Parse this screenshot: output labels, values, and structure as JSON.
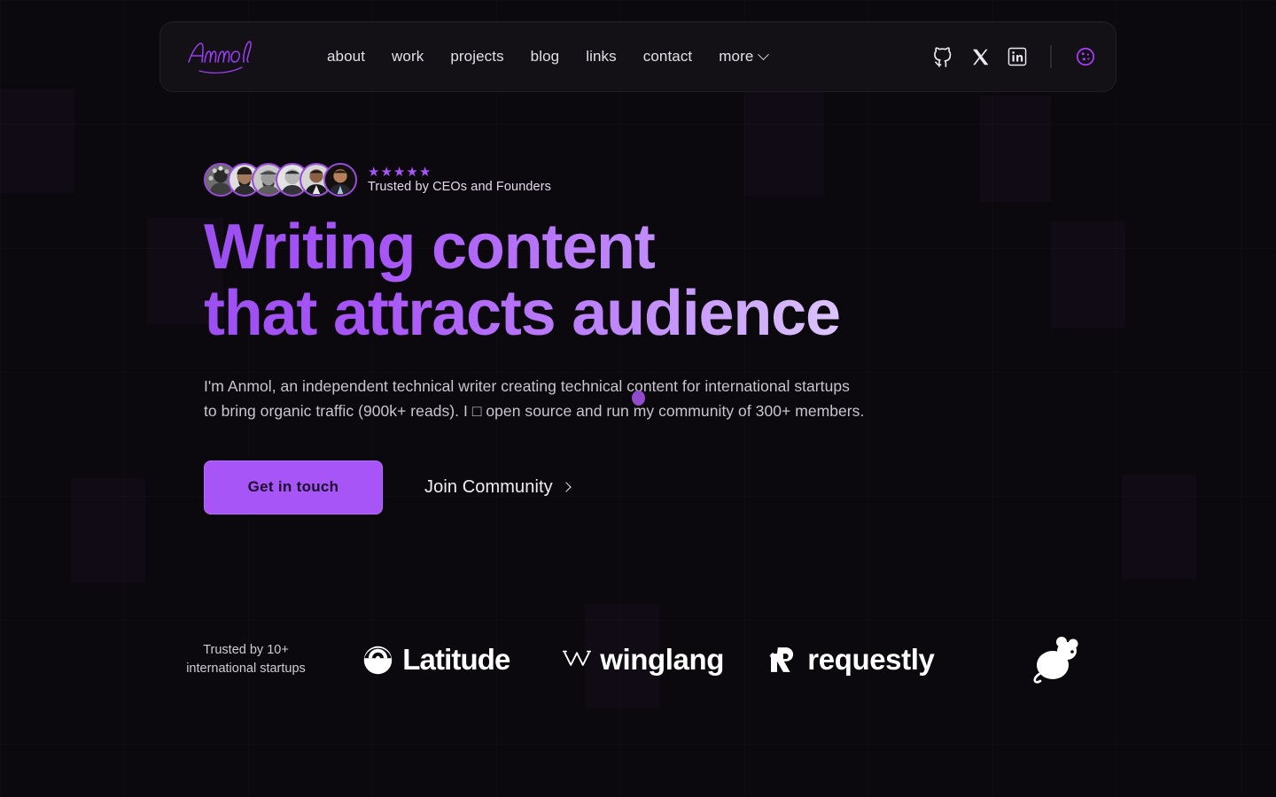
{
  "navbar": {
    "brand": "Anmol",
    "links": [
      {
        "label": "about"
      },
      {
        "label": "work"
      },
      {
        "label": "projects"
      },
      {
        "label": "blog"
      },
      {
        "label": "links"
      },
      {
        "label": "contact"
      },
      {
        "label": "more"
      }
    ],
    "social": [
      {
        "name": "github-icon"
      },
      {
        "name": "x-twitter-icon"
      },
      {
        "name": "linkedin-icon"
      }
    ],
    "theme_toggle": "palette-icon"
  },
  "hero": {
    "avatar_count": 6,
    "rating_stars": 5,
    "star_glyph": "★",
    "trusted_label": "Trusted by CEOs and Founders",
    "headline": "Writing content\nthat attracts audience",
    "subhead": "I'm Anmol, an independent technical writer creating technical content for international startups\nto bring organic traffic (900k+ reads). I □ open source and run my community of 300+ members.",
    "primary_cta": "Get in touch",
    "secondary_cta": "Join Community"
  },
  "clients": {
    "label": "Trusted by 10+\ninternational startups",
    "logos": [
      {
        "name": "latitude-logo",
        "text": "Latitude"
      },
      {
        "name": "winglang-logo",
        "text": "winglang"
      },
      {
        "name": "requestly-logo",
        "text": "requestly"
      },
      {
        "name": "mouse-logo",
        "text": ""
      }
    ]
  },
  "colors": {
    "accent": "#a855f7",
    "accent_deep": "#9b4ff0",
    "background": "#0b090d",
    "navbar_bg": "#131016",
    "navbar_border": "#231d29",
    "text_primary": "#f0eef3",
    "text_muted": "#c9c6cf"
  }
}
